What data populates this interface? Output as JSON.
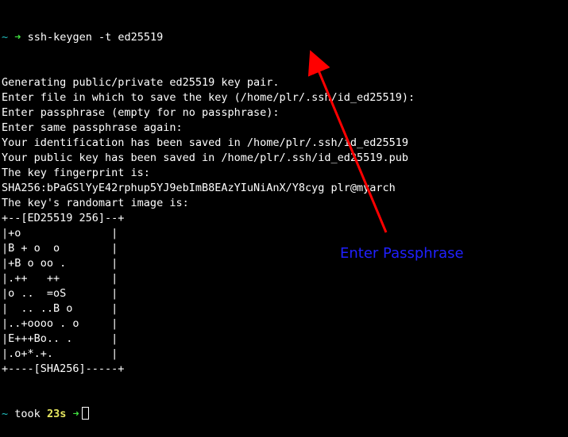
{
  "terminal": {
    "prompt_tilde": "~",
    "prompt_arrow": "➜",
    "command": "ssh-keygen -t ed25519",
    "output": [
      "Generating public/private ed25519 key pair.",
      "Enter file in which to save the key (/home/plr/.ssh/id_ed25519):",
      "Enter passphrase (empty for no passphrase):",
      "Enter same passphrase again:",
      "Your identification has been saved in /home/plr/.ssh/id_ed25519",
      "Your public key has been saved in /home/plr/.ssh/id_ed25519.pub",
      "The key fingerprint is:",
      "SHA256:bPaGSlYyE42rphup5YJ9ebImB8EAzYIuNiAnX/Y8cyg plr@myarch",
      "The key's randomart image is:",
      "+--[ED25519 256]--+",
      "|+o              |",
      "|B + o  o        |",
      "|+B o oo .       |",
      "|.++   ++        |",
      "|o ..  =oS       |",
      "|  .. ..B o      |",
      "|..+oooo . o     |",
      "|E+++Bo.. .      |",
      "|.o+*.+.         |",
      "+----[SHA256]-----+"
    ],
    "final_prompt_tilde": "~",
    "final_prompt_took": "took",
    "final_prompt_duration": "23s",
    "final_prompt_arrow": "➜"
  },
  "annotation": {
    "label": "Enter Passphrase",
    "color": "#2020ff",
    "arrow_color": "#ff0000"
  }
}
